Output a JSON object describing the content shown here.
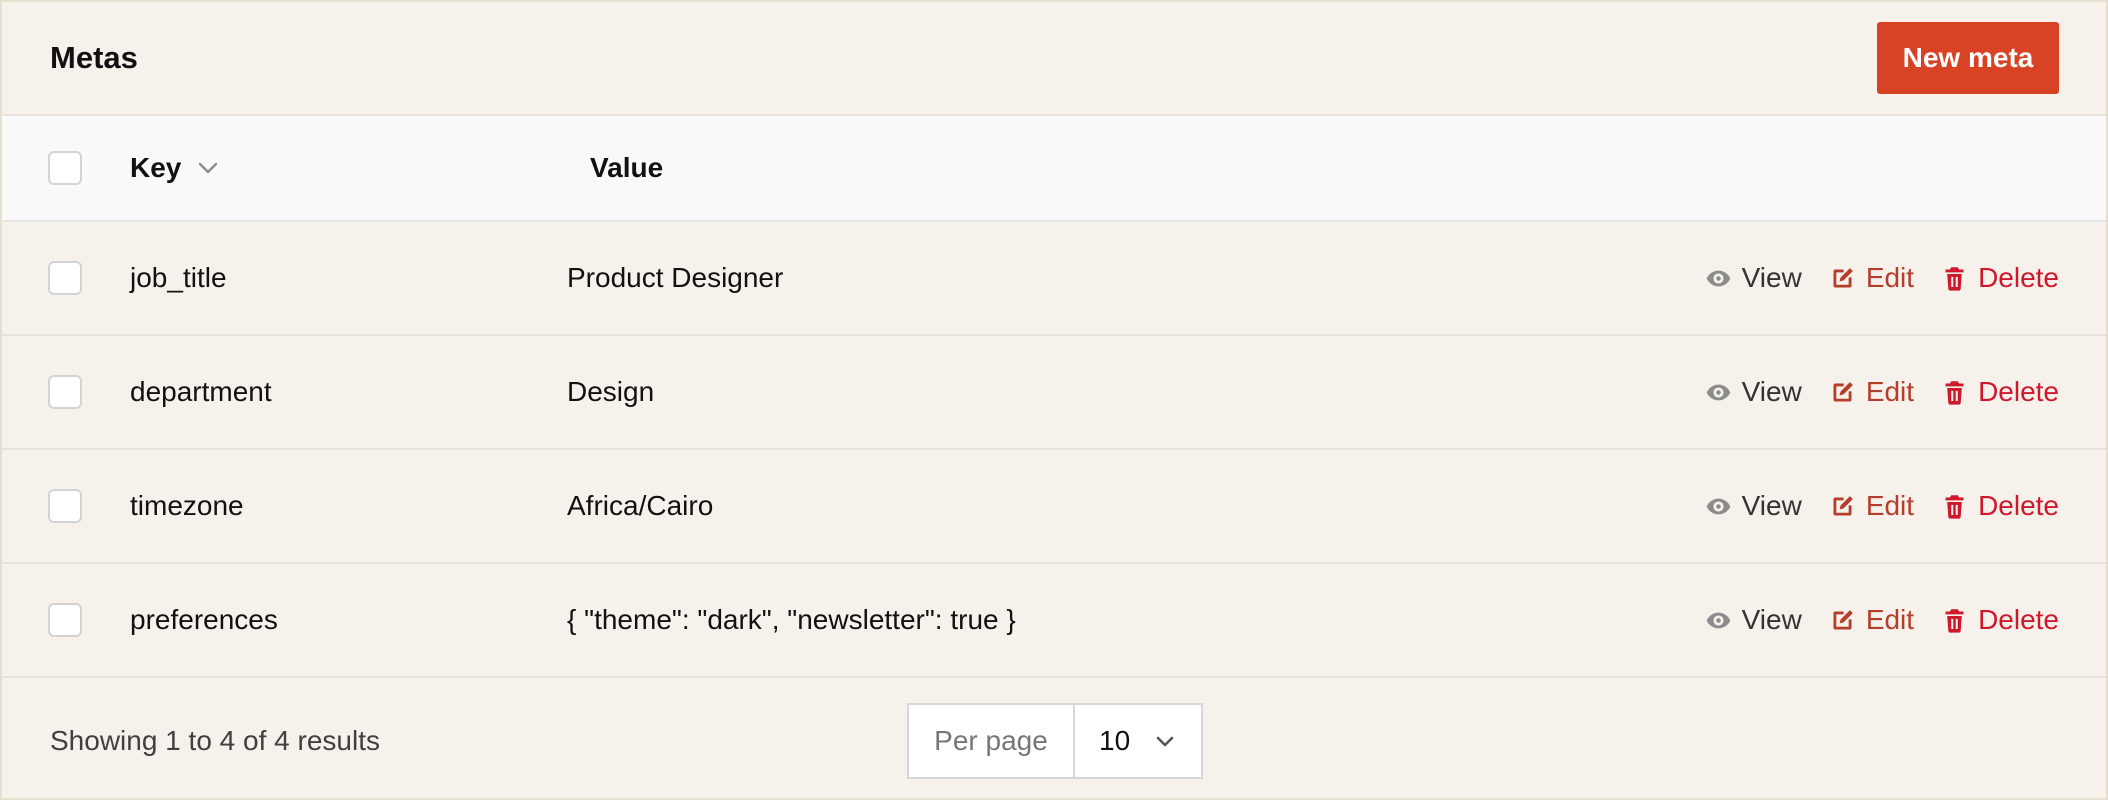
{
  "header": {
    "title": "Metas",
    "new_button_label": "New meta"
  },
  "table": {
    "columns": {
      "key": "Key",
      "value": "Value"
    },
    "sort_icon": "chevron-down-icon",
    "rows": [
      {
        "key": "job_title",
        "value": "Product Designer"
      },
      {
        "key": "department",
        "value": "Design"
      },
      {
        "key": "timezone",
        "value": "Africa/Cairo"
      },
      {
        "key": "preferences",
        "value": "{ \"theme\": \"dark\", \"newsletter\": true }"
      }
    ],
    "actions": {
      "view": "View",
      "edit": "Edit",
      "delete": "Delete"
    },
    "action_icons": [
      "eye-icon",
      "edit-icon",
      "trash-icon"
    ]
  },
  "footer": {
    "showing_text": "Showing 1 to 4 of 4 results",
    "per_page_label": "Per page",
    "per_page_value": "10"
  },
  "colors": {
    "accent": "#d84326",
    "background": "#f6f1ea",
    "edit": "#b43d2c",
    "delete": "#d0182d"
  }
}
